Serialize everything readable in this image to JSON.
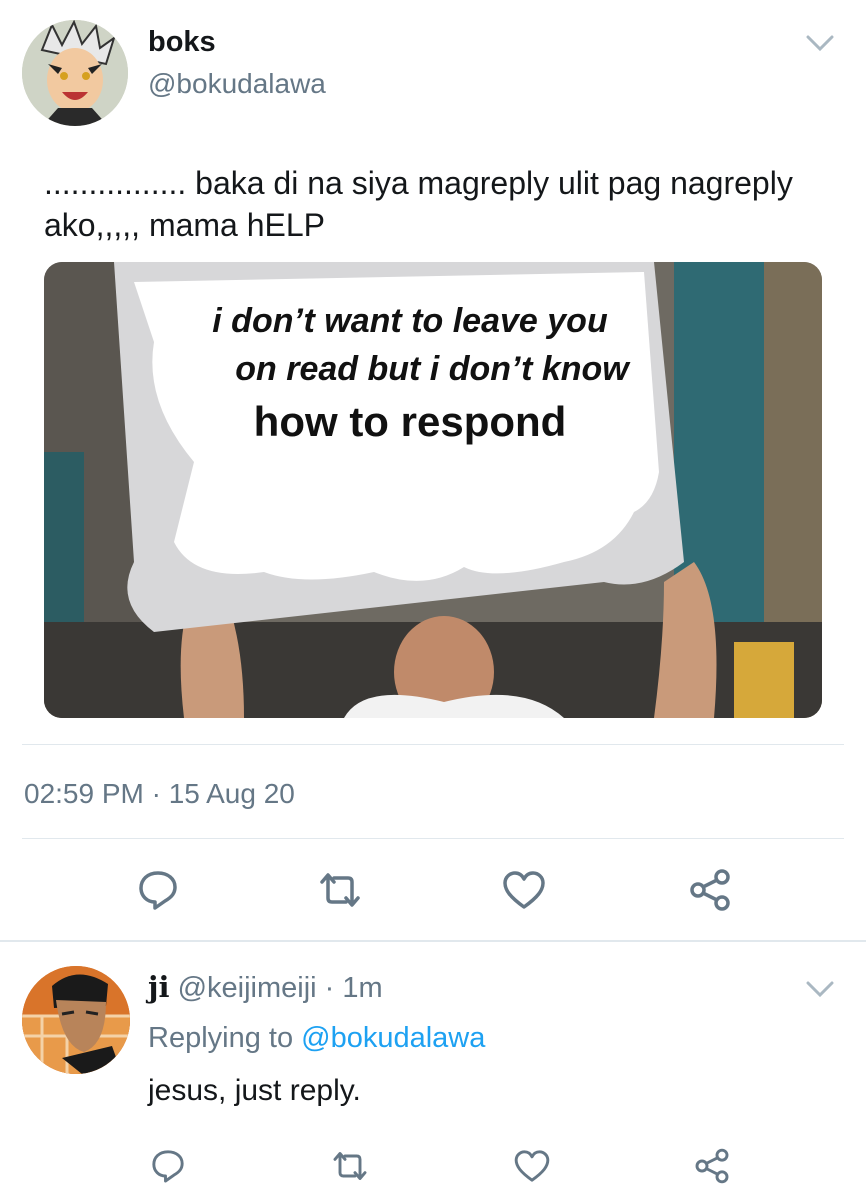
{
  "tweet": {
    "display_name": "boks",
    "handle": "@bokudalawa",
    "text": "................ baka di na siya magreply ulit pag nagreply ako,,,,, mama hELP",
    "media_sign": {
      "line1": "i don’t want to leave you",
      "line2": "on read but i don’t know",
      "line3": "how to respond"
    },
    "timestamp": "02:59 PM · 15 Aug 20",
    "actions": [
      "reply-icon",
      "retweet-icon",
      "like-icon",
      "share-icon"
    ]
  },
  "reply": {
    "display_name": "ji",
    "handle_time": "@keijimeiji · 1m",
    "replying_prefix": "Replying to",
    "replying_mention": "@bokudalawa",
    "text": "jesus, just reply.",
    "actions": [
      "reply-icon",
      "retweet-icon",
      "like-icon",
      "share-icon"
    ]
  },
  "colors": {
    "text": "#14171a",
    "secondary": "#657786",
    "link": "#1da1f2",
    "divider": "#e1e8ed"
  }
}
